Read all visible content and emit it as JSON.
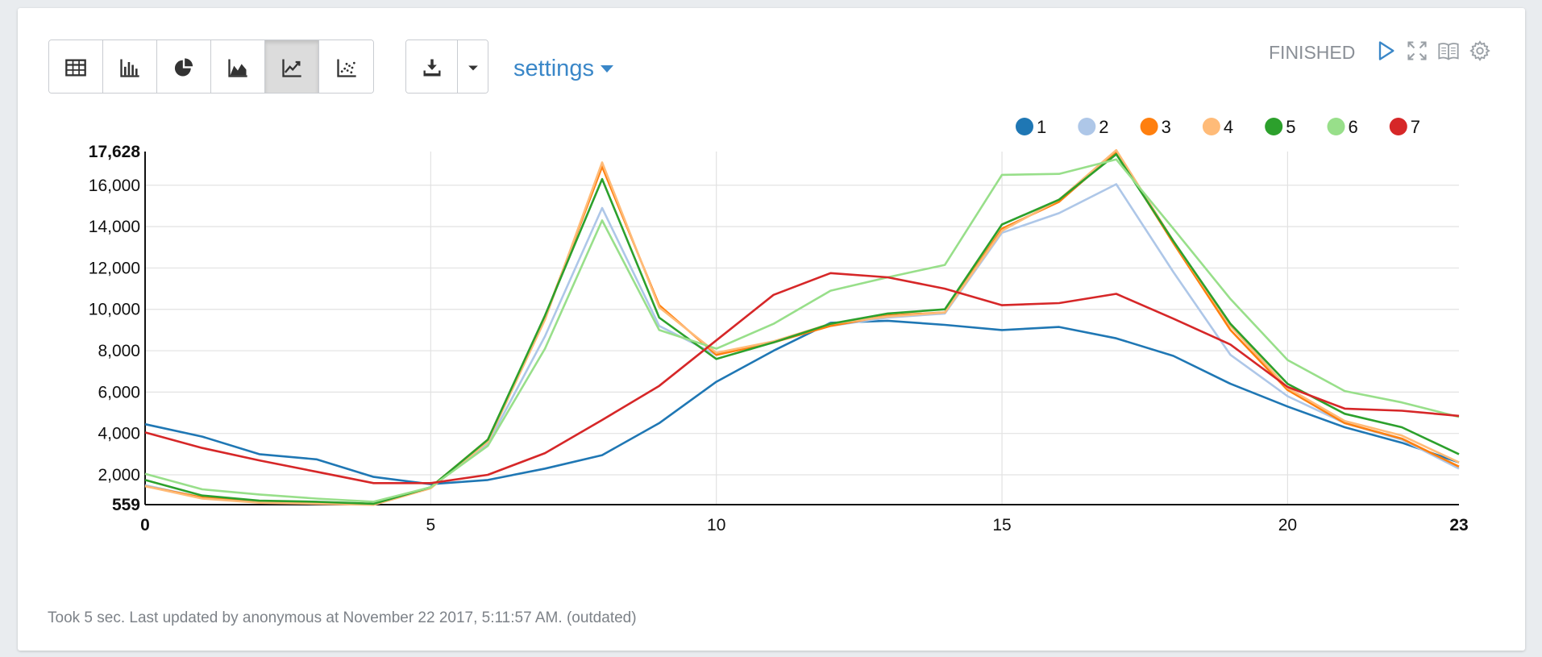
{
  "toolbar": {
    "viz_buttons": [
      {
        "name": "table-view-button",
        "icon": "table-icon",
        "active": false
      },
      {
        "name": "bar-chart-button",
        "icon": "bar-chart-icon",
        "active": false
      },
      {
        "name": "pie-chart-button",
        "icon": "pie-chart-icon",
        "active": false
      },
      {
        "name": "area-chart-button",
        "icon": "area-chart-icon",
        "active": false
      },
      {
        "name": "line-chart-button",
        "icon": "line-chart-icon",
        "active": true
      },
      {
        "name": "scatter-chart-button",
        "icon": "scatter-chart-icon",
        "active": false
      }
    ],
    "download_icon": "download-icon",
    "settings_label": "settings"
  },
  "header": {
    "status": "FINISHED",
    "icons": [
      "play-icon",
      "expand-icon",
      "book-icon",
      "gear-icon"
    ]
  },
  "footer": {
    "text": "Took 5 sec. Last updated by anonymous at November 22 2017, 5:11:57 AM. (outdated)"
  },
  "colors": {
    "accent": "#3a87c8",
    "status_text": "#8a8f96"
  },
  "chart_data": {
    "type": "line",
    "x": [
      0,
      1,
      2,
      3,
      4,
      5,
      6,
      7,
      8,
      9,
      10,
      11,
      12,
      13,
      14,
      15,
      16,
      17,
      18,
      19,
      20,
      21,
      22,
      23
    ],
    "xticks": [
      "0",
      "5",
      "10",
      "15",
      "20",
      "23"
    ],
    "yticks": [
      "559",
      "2,000",
      "4,000",
      "6,000",
      "8,000",
      "10,000",
      "12,000",
      "14,000",
      "16,000",
      "17,628"
    ],
    "ylim": [
      559,
      17628
    ],
    "xlim": [
      0,
      23
    ],
    "grid": true,
    "legend_position": "top-right",
    "series": [
      {
        "name": "1",
        "color": "#1f77b4",
        "values": [
          4450,
          3850,
          3000,
          2750,
          1900,
          1550,
          1750,
          2300,
          2950,
          4500,
          6500,
          8000,
          9350,
          9450,
          9250,
          9000,
          9150,
          8600,
          7750,
          6400,
          5300,
          4300,
          3550,
          2600
        ]
      },
      {
        "name": "2",
        "color": "#aec7e8",
        "values": [
          1500,
          900,
          700,
          650,
          600,
          1400,
          3500,
          8700,
          14900,
          9200,
          7800,
          8450,
          9200,
          9600,
          9800,
          13700,
          14650,
          16050,
          11800,
          7800,
          5800,
          4500,
          3700,
          2300
        ]
      },
      {
        "name": "3",
        "color": "#ff7f0e",
        "values": [
          1450,
          900,
          700,
          650,
          600,
          1400,
          3700,
          9600,
          16900,
          10200,
          7800,
          8400,
          9200,
          9700,
          9850,
          13900,
          15200,
          17600,
          13200,
          9000,
          6100,
          4500,
          3750,
          2400
        ]
      },
      {
        "name": "4",
        "color": "#ffbb78",
        "values": [
          1450,
          850,
          650,
          600,
          550,
          1350,
          3600,
          9500,
          17100,
          10100,
          7900,
          8450,
          9300,
          9650,
          9850,
          13800,
          15300,
          17700,
          13300,
          9200,
          6200,
          4600,
          3900,
          2600
        ]
      },
      {
        "name": "5",
        "color": "#2ca02c",
        "values": [
          1750,
          1000,
          750,
          700,
          600,
          1400,
          3700,
          9700,
          16300,
          9600,
          7600,
          8400,
          9300,
          9800,
          10000,
          14100,
          15300,
          17500,
          13300,
          9300,
          6400,
          4950,
          4300,
          3000
        ]
      },
      {
        "name": "6",
        "color": "#98df8a",
        "values": [
          2050,
          1300,
          1050,
          850,
          700,
          1400,
          3400,
          8100,
          14300,
          9000,
          8100,
          9300,
          10900,
          11550,
          12150,
          16500,
          16550,
          17250,
          13900,
          10500,
          7550,
          6050,
          5500,
          4800
        ]
      },
      {
        "name": "7",
        "color": "#d62728",
        "values": [
          4050,
          3300,
          2700,
          2150,
          1600,
          1600,
          2000,
          3050,
          4650,
          6300,
          8500,
          10700,
          11750,
          11550,
          11000,
          10200,
          10300,
          10750,
          9550,
          8300,
          6250,
          5200,
          5100,
          4850
        ]
      }
    ]
  }
}
